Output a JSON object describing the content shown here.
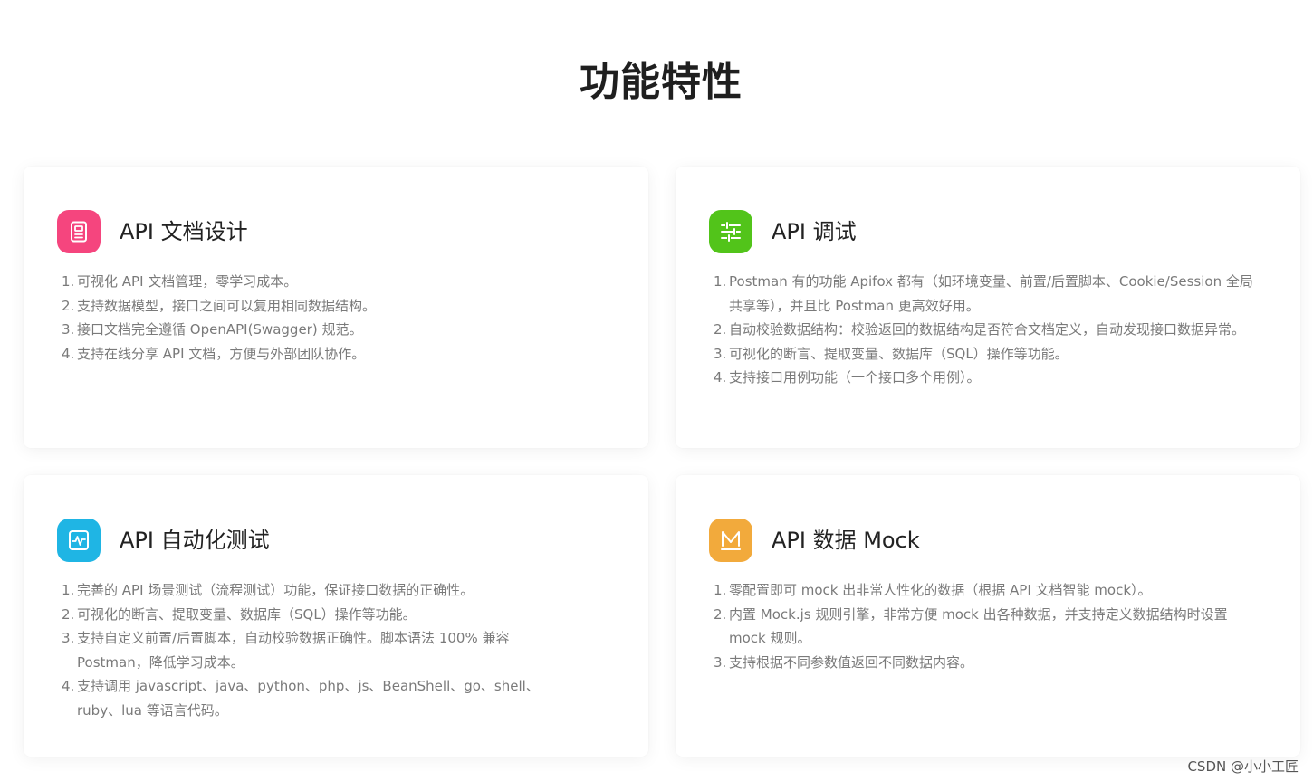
{
  "page": {
    "title": "功能特性"
  },
  "cards": [
    {
      "title": "API 文档设计",
      "icon": "document-icon",
      "icon_color": "#f5457e",
      "items": [
        "可视化 API 文档管理，零学习成本。",
        "支持数据模型，接口之间可以复用相同数据结构。",
        "接口文档完全遵循 OpenAPI(Swagger) 规范。",
        "支持在线分享 API 文档，方便与外部团队协作。"
      ]
    },
    {
      "title": "API 调试",
      "icon": "sliders-icon",
      "icon_color": "#52c41a",
      "items": [
        "Postman 有的功能 Apifox 都有（如环境变量、前置/后置脚本、Cookie/Session 全局共享等），并且比 Postman 更高效好用。",
        "自动校验数据结构：校验返回的数据结构是否符合文档定义，自动发现接口数据异常。",
        "可视化的断言、提取变量、数据库（SQL）操作等功能。",
        "支持接口用例功能（一个接口多个用例）。"
      ]
    },
    {
      "title": "API 自动化测试",
      "icon": "activity-chart-icon",
      "icon_color": "#1fb5e4",
      "items": [
        "完善的 API 场景测试（流程测试）功能，保证接口数据的正确性。",
        "可视化的断言、提取变量、数据库（SQL）操作等功能。",
        "支持自定义前置/后置脚本，自动校验数据正确性。脚本语法 100% 兼容 Postman，降低学习成本。",
        "支持调用 javascript、java、python、php、js、BeanShell、go、shell、ruby、lua 等语言代码。"
      ]
    },
    {
      "title": "API 数据 Mock",
      "icon": "mock-m-icon",
      "icon_color": "#f2aa3c",
      "items": [
        "零配置即可 mock 出非常人性化的数据（根据 API 文档智能 mock）。",
        "内置 Mock.js 规则引擎，非常方便 mock 出各种数据，并支持定义数据结构时设置 mock 规则。",
        "支持根据不同参数值返回不同数据内容。"
      ]
    }
  ],
  "watermark": "CSDN @小小工匠",
  "list_numbers": [
    "1.",
    "2.",
    "3.",
    "4."
  ]
}
